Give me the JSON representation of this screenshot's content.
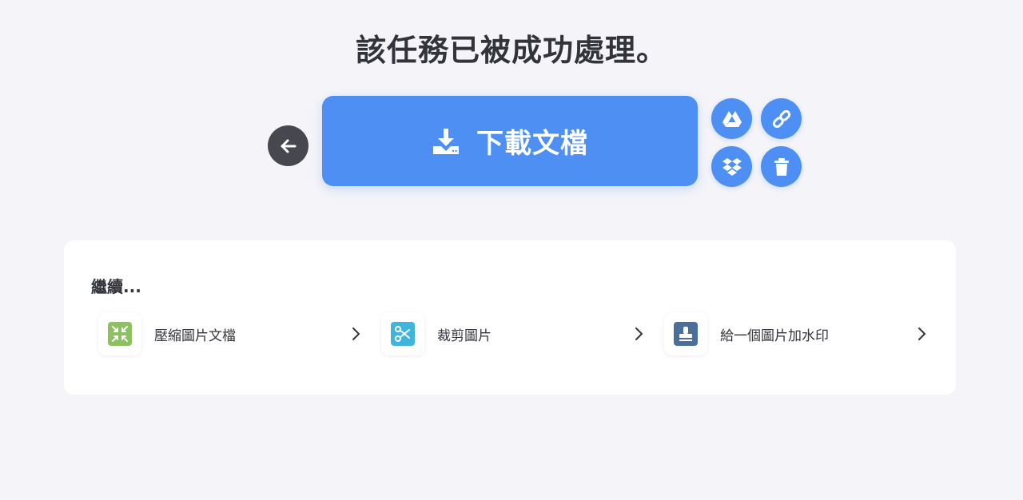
{
  "header": {
    "title": "該任務已被成功處理。"
  },
  "actions": {
    "back_icon": "arrow-left-icon",
    "download_label": "下載文檔",
    "download_icon": "download-icon",
    "side_icons": [
      "google-drive-icon",
      "link-icon",
      "dropbox-icon",
      "trash-icon"
    ]
  },
  "continue": {
    "heading": "繼續...",
    "tools": [
      {
        "label": "壓縮圖片文檔",
        "icon": "compress-icon",
        "color": "#8cc061"
      },
      {
        "label": "裁剪圖片",
        "icon": "scissors-icon",
        "color": "#3fb5dc"
      },
      {
        "label": "給一個圖片加水印",
        "icon": "stamp-icon",
        "color": "#4a6f9b"
      }
    ]
  },
  "colors": {
    "background": "#f4f4f9",
    "primary": "#4d8ff2",
    "back_button": "#47474f",
    "card": "#ffffff"
  }
}
